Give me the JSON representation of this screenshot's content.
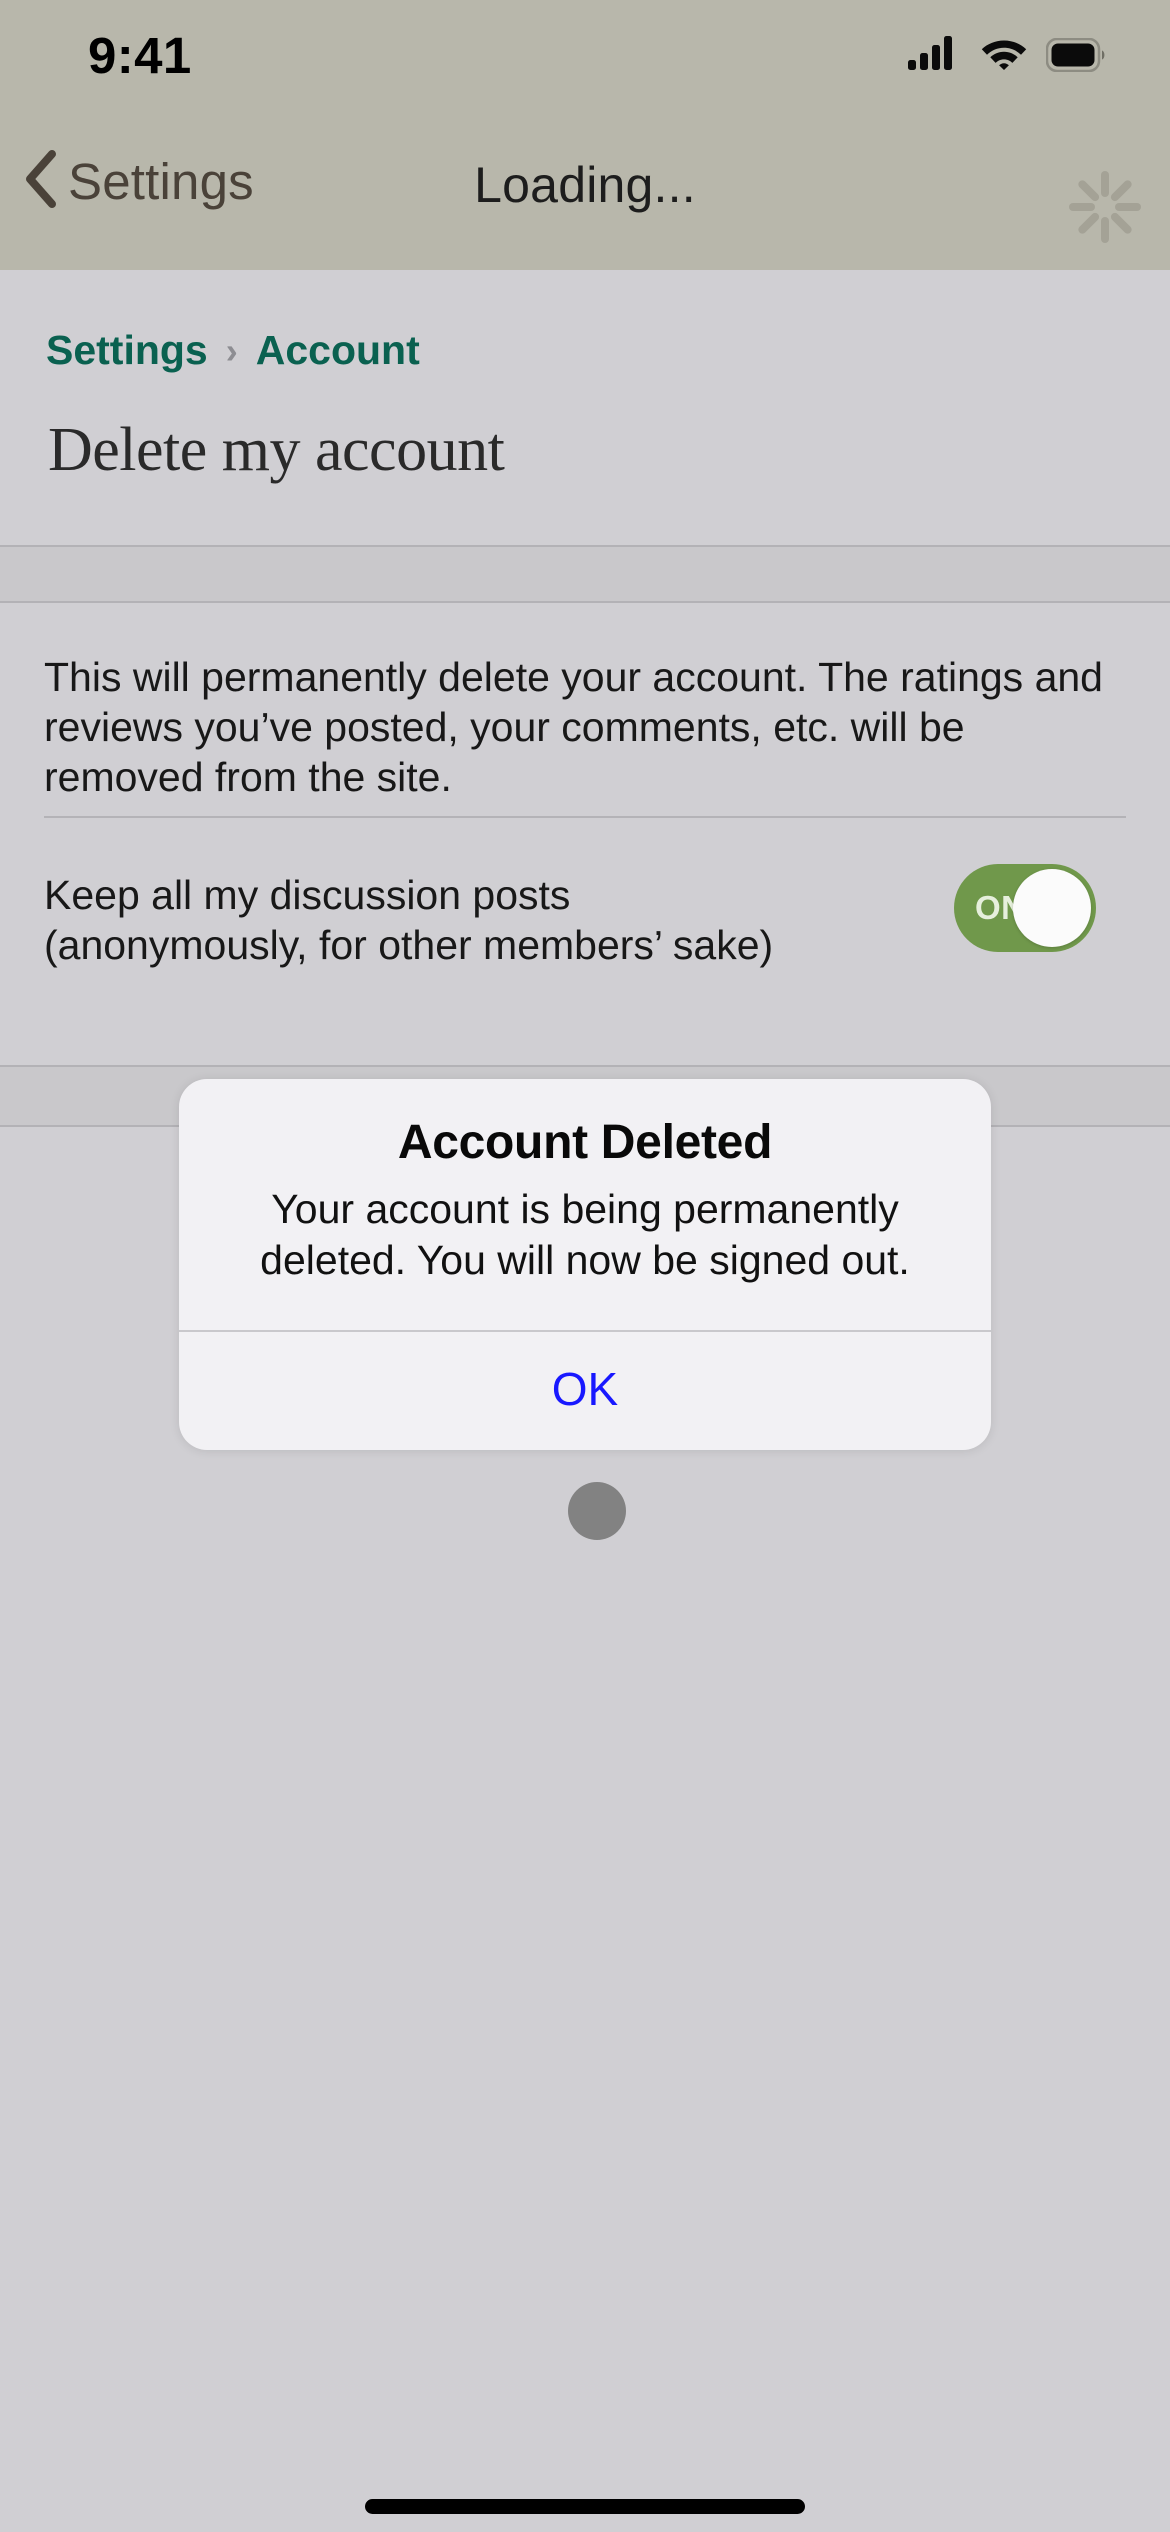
{
  "status_bar": {
    "time": "9:41",
    "cellular_icon": "cellular-signal-icon",
    "wifi_icon": "wifi-icon",
    "battery_icon": "battery-full-icon"
  },
  "nav_bar": {
    "back_label": "Settings",
    "back_icon": "chevron-left-icon",
    "title": "Loading...",
    "spinner_icon": "activity-spinner-icon"
  },
  "breadcrumb": {
    "items": [
      "Settings",
      "Account"
    ],
    "separator": "›",
    "link_color": "#0a6150"
  },
  "page": {
    "title": "Delete my account",
    "description": "This will permanently delete your account. The ratings and reviews you’ve posted, your comments, etc. will be removed from the site."
  },
  "toggle_row": {
    "label": "Keep all my discussion posts (anonymously, for other members’ sake)",
    "state_label": "ON",
    "on": true,
    "on_color": "#70984b"
  },
  "alert": {
    "title": "Account Deleted",
    "message": "Your account is being permanently deleted. You will now be signed out.",
    "ok_label": "OK",
    "ok_color": "#1818ff",
    "background": "#f2f1f4"
  },
  "colors": {
    "chrome_background": "#b8b7ab",
    "content_background": "#d0cfd3",
    "band_background": "#c9c8cb",
    "cursor_dot": "#828282"
  },
  "cursor": {
    "name": "touch-indicator"
  },
  "home_indicator": {
    "name": "home-indicator"
  }
}
